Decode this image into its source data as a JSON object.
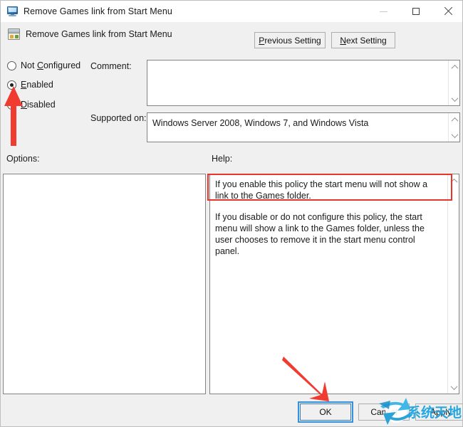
{
  "window": {
    "title": "Remove Games link from Start Menu",
    "title_icon": "computer-monitor-icon",
    "controls": {
      "minimize": "minimize-icon",
      "maximize": "maximize-icon",
      "close": "close-icon"
    }
  },
  "header": {
    "title": "Remove Games link from Start Menu",
    "icon": "policy-setting-icon",
    "previous_setting": "Previous Setting",
    "previous_accel": "P",
    "next_setting": "Next Setting",
    "next_accel": "N"
  },
  "state": {
    "options": [
      {
        "label": "Not Configured",
        "accel": "C",
        "selected": false
      },
      {
        "label": "Enabled",
        "accel": "E",
        "selected": true
      },
      {
        "label": "Disabled",
        "accel": "D",
        "selected": false
      }
    ]
  },
  "comment": {
    "label": "Comment:",
    "value": ""
  },
  "supported": {
    "label": "Supported on:",
    "value": "Windows Server 2008, Windows 7, and Windows Vista"
  },
  "options_panel": {
    "label": "Options:",
    "items": []
  },
  "help_panel": {
    "label": "Help:",
    "paragraph_1": "If you enable this policy the start menu will not show a link to the Games folder.",
    "paragraph_2": "If you disable or do not configure this policy, the start menu will show a link to the Games folder, unless the user chooses to remove it in the start menu control panel."
  },
  "buttons": {
    "ok": "OK",
    "cancel": "Cancel",
    "apply": "Apply"
  },
  "annotations": {
    "highlight_color": "#e8352c",
    "arrow_color": "#ef3b30",
    "arrow_enabled_target": "Enabled",
    "arrow_ok_target": "OK",
    "highlight_target": "help-paragraph-1"
  },
  "watermark": {
    "text": "系统天地",
    "color": "#27a7e0",
    "logo": "refresh-circle-logo"
  }
}
